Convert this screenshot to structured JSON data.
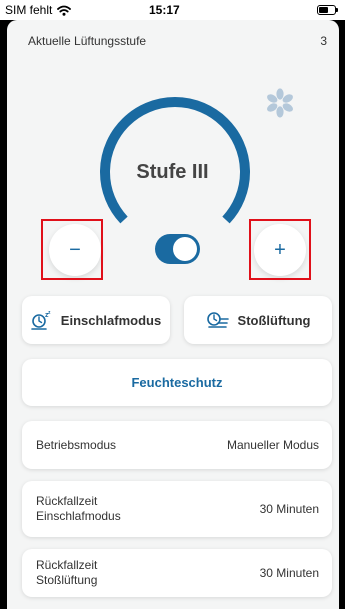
{
  "status_bar": {
    "carrier": "SIM fehlt",
    "time": "15:17"
  },
  "level": {
    "title": "Aktuelle Lüftungsstufe",
    "value": "3",
    "label": "Stufe III"
  },
  "controls": {
    "minus": "−",
    "plus": "+",
    "toggle_on": true
  },
  "modes": {
    "sleep_label": "Einschlafmodus",
    "boost_label": "Stoßlüftung"
  },
  "humidity": {
    "label": "Feuchteschutz"
  },
  "settings": [
    {
      "label": "Betriebsmodus",
      "value": "Manueller Modus"
    },
    {
      "label_line1": "Rückfallzeit",
      "label_line2": "Einschlafmodus",
      "value": "30 Minuten"
    },
    {
      "label_line1": "Rückfallzeit",
      "label_line2": "Stoßlüftung",
      "value": "30 Minuten"
    }
  ],
  "colors": {
    "accent": "#1a6aa1",
    "highlight": "#e0101a",
    "background": "#f4f5f5",
    "fan_icon": "#b4c8da"
  },
  "icons": {
    "wifi": "wifi-icon",
    "battery": "battery-icon",
    "fan": "fan-icon",
    "sleep": "sleep-mode-icon",
    "boost": "boost-ventilation-icon"
  }
}
